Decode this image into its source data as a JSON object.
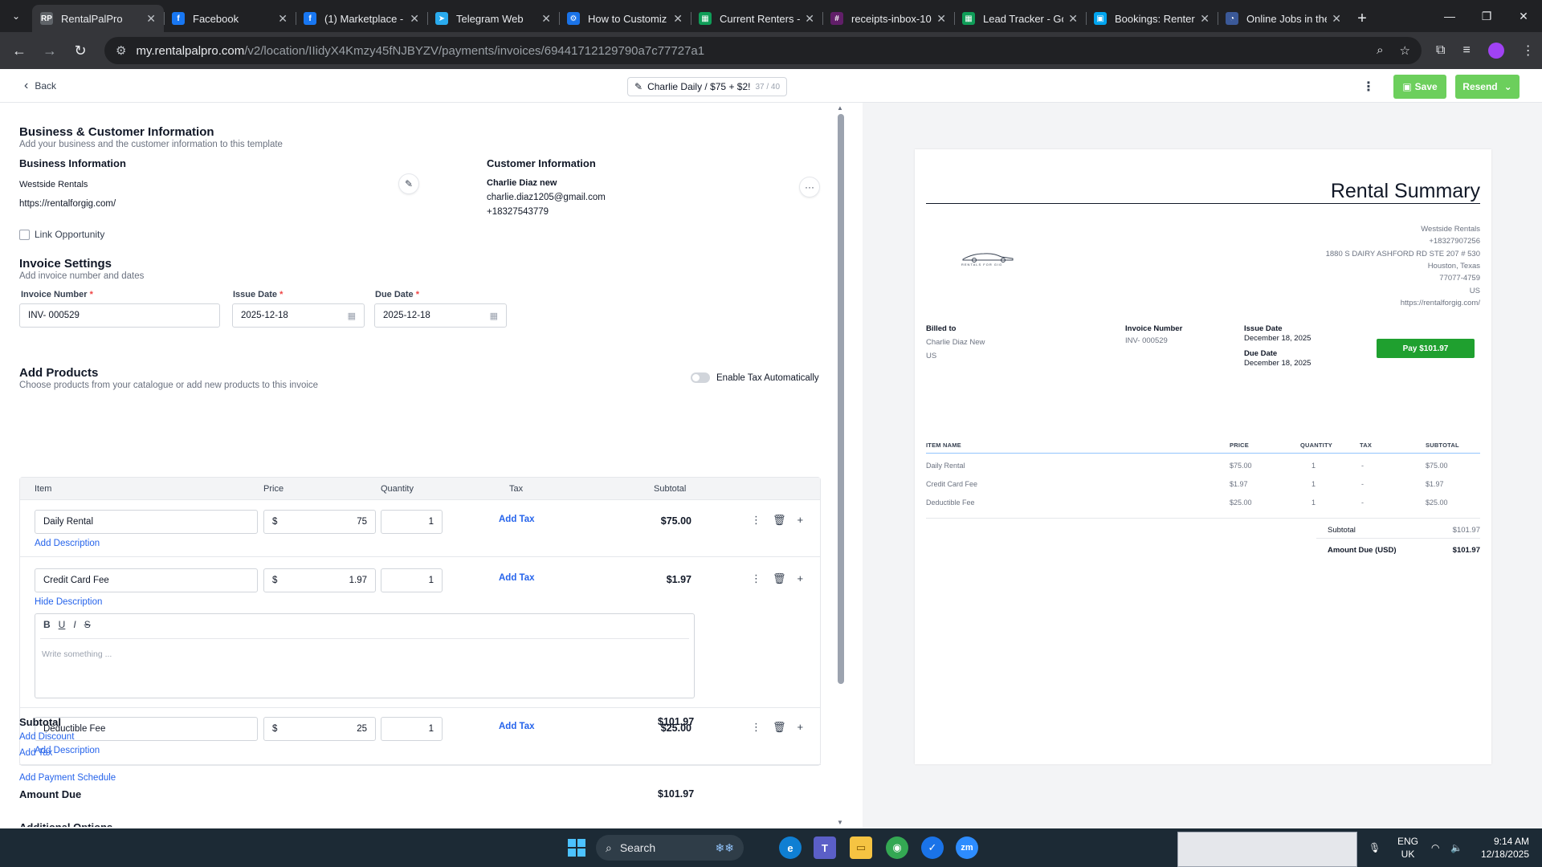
{
  "browser": {
    "tabs": [
      {
        "title": "RentalPalPro",
        "active": true,
        "fav": "RP",
        "color": "#5f6368"
      },
      {
        "title": "Facebook",
        "fav": "f",
        "color": "#1877f2"
      },
      {
        "title": "(1) Marketplace -",
        "fav": "f",
        "color": "#1877f2"
      },
      {
        "title": "Telegram Web",
        "fav": "➤",
        "color": "#2aabee"
      },
      {
        "title": "How to Customiz",
        "fav": "⚙",
        "color": "#1a73e8"
      },
      {
        "title": "Current Renters -",
        "fav": "▦",
        "color": "#0f9d58"
      },
      {
        "title": "receipts-inbox-10",
        "fav": "#",
        "color": "#611f69"
      },
      {
        "title": "Lead Tracker - Go",
        "fav": "▦",
        "color": "#0f9d58"
      },
      {
        "title": "Bookings: Renter",
        "fav": "▣",
        "color": "#00a4ef"
      },
      {
        "title": "Online Jobs in the",
        "fav": "◔",
        "color": "#3b5998"
      }
    ],
    "url_host": "my.rentalpalpro.com",
    "url_path": "/v2/location/IIidyX4Kmzy45fNJBYZV/payments/invoices/69441712129790a7c77727a1"
  },
  "header": {
    "back_label": "Back",
    "invoice_name": "Charlie Daily / $75 + $2!",
    "name_count": "37 / 40",
    "save_label": "Save",
    "resend_label": "Resend"
  },
  "info": {
    "section_title": "Business & Customer Information",
    "section_sub": "Add your business and the customer information to this template",
    "business_title": "Business Information",
    "business_name": "Westside Rentals",
    "business_site": "https://rentalforgig.com/",
    "customer_title": "Customer Information",
    "customer_name": "Charlie Diaz new",
    "customer_email": "charlie.diaz1205@gmail.com",
    "customer_phone": "+18327543779",
    "link_opportunity": "Link Opportunity"
  },
  "settings": {
    "title": "Invoice Settings",
    "sub": "Add invoice number and dates",
    "number_label": "Invoice Number",
    "number_value": "INV- 000529",
    "issue_label": "Issue Date",
    "issue_value": "2025-12-18",
    "due_label": "Due Date",
    "due_value": "2025-12-18"
  },
  "products": {
    "title": "Add Products",
    "sub": "Choose products from your catalogue or add new products to this invoice",
    "tax_toggle_label": "Enable Tax Automatically",
    "headers": {
      "item": "Item",
      "price": "Price",
      "quantity": "Quantity",
      "tax": "Tax",
      "subtotal": "Subtotal"
    },
    "currency": "$",
    "add_tax": "Add Tax",
    "rows": [
      {
        "name": "Daily Rental",
        "price": "75",
        "qty": "1",
        "subtotal": "$75.00",
        "desc_link": "Add Description"
      },
      {
        "name": "Credit Card Fee",
        "price": "1.97",
        "qty": "1",
        "subtotal": "$1.97",
        "desc_link": "Hide Description"
      },
      {
        "name": "Deductible Fee",
        "price": "25",
        "qty": "1",
        "subtotal": "$25.00",
        "desc_link": "Add Description"
      }
    ],
    "editor_placeholder": "Write something ..."
  },
  "totals": {
    "subtotal_label": "Subtotal",
    "subtotal_value": "$101.97",
    "add_discount": "Add Discount",
    "add_tax": "Add Tax",
    "add_schedule": "Add Payment Schedule",
    "amount_due_label": "Amount Due",
    "amount_due_value": "$101.97",
    "additional_options": "Additional Options"
  },
  "preview": {
    "title": "Rental Summary",
    "logo_text": "RENTALS FOR GIG",
    "biz_name": "Westside Rentals",
    "biz_phone": "+18327907256",
    "biz_addr1": "1880 S DAIRY ASHFORD RD STE 207 # 530",
    "biz_city": "Houston, Texas",
    "biz_zip": "77077-4759",
    "biz_country": "US",
    "biz_site": "https://rentalforgig.com/",
    "billed_to_label": "Billed to",
    "billed_name": "Charlie Diaz New",
    "billed_country": "US",
    "invoice_number_label": "Invoice Number",
    "invoice_number": "INV- 000529",
    "issue_label": "Issue Date",
    "issue_date": "December 18, 2025",
    "due_label": "Due Date",
    "due_date": "December 18, 2025",
    "pay_label": "Pay $101.97",
    "th": {
      "item": "ITEM NAME",
      "price": "PRICE",
      "qty": "QUANTITY",
      "tax": "TAX",
      "subtotal": "SUBTOTAL"
    },
    "rows": [
      {
        "item": "Daily Rental",
        "price": "$75.00",
        "qty": "1",
        "tax": "-",
        "subtotal": "$75.00"
      },
      {
        "item": "Credit Card Fee",
        "price": "$1.97",
        "qty": "1",
        "tax": "-",
        "subtotal": "$1.97"
      },
      {
        "item": "Deductible Fee",
        "price": "$25.00",
        "qty": "1",
        "tax": "-",
        "subtotal": "$25.00"
      }
    ],
    "subtotal_label": "Subtotal",
    "subtotal_value": "$101.97",
    "amount_due_label": "Amount Due (USD)",
    "amount_due_value": "$101.97"
  },
  "taskbar": {
    "search_label": "Search",
    "lang1": "ENG",
    "lang2": "UK",
    "time": "9:14 AM",
    "date": "12/18/2025"
  }
}
